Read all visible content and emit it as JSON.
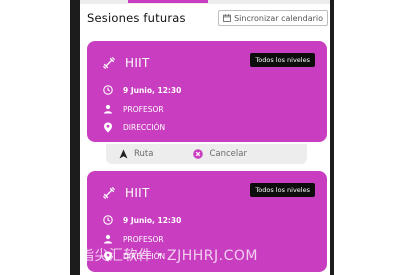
{
  "header": {
    "title": "Sesiones futuras",
    "sync_label": "Sincronizar calendario"
  },
  "sessions": [
    {
      "name": "HIIT",
      "level": "Todos los niveles",
      "date": "9 Junio, 12:30",
      "instructor": "PROFESOR",
      "address": "DIRECCIÓN"
    },
    {
      "name": "HIIT",
      "level": "Todos los niveles",
      "date": "9 Junio, 12:30",
      "instructor": "PROFESOR",
      "address": "DIRECCIÓN"
    }
  ],
  "actions": {
    "route_label": "Ruta",
    "cancel_label": "Cancelar"
  },
  "watermark": "指尖汇软件・ZJHHRJ.COM",
  "colors": {
    "accent": "#c93ec0",
    "badge_bg": "#0d0d0d",
    "actions_bg": "#ededed",
    "cancel_icon": "#c93ec0"
  },
  "icons": {
    "dumbbell": "dumbbell-icon",
    "clock": "clock-icon",
    "person": "person-icon",
    "pin": "location-pin-icon",
    "calendar": "calendar-icon",
    "navigate": "navigation-arrow-icon",
    "cancel": "cancel-circle-icon"
  }
}
